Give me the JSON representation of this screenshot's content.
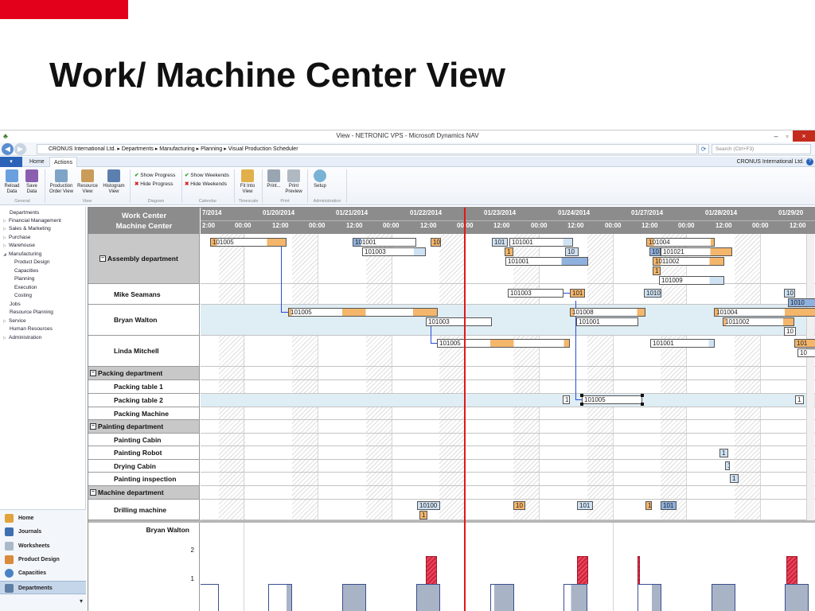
{
  "slide": {
    "title": "Work/ Machine Center View"
  },
  "window": {
    "title": "View - NETRONIC VPS - Microsoft Dynamics NAV",
    "min": "–",
    "max": "▫",
    "close": "×"
  },
  "address": {
    "breadcrumb": "CRONUS International Ltd.  ▸  Departments  ▸  Manufacturing  ▸  Planning  ▸  Visual Production Scheduler",
    "search_placeholder": "Search (Ctrl+F3)"
  },
  "ribbon": {
    "tabs": [
      "Home",
      "Actions"
    ],
    "company": "CRONUS International Ltd.",
    "buttons": {
      "reload": "Reload Data",
      "save": "Save Data",
      "prod_order_view": "Production Order View",
      "resource_view": "Resource View",
      "histogram_view": "Histogram View",
      "fit_into_view": "Fit Into View",
      "print": "Print...",
      "print_preview": "Print Preview",
      "setup": "Setup"
    },
    "small": {
      "show_progress": "Show Progress",
      "hide_progress": "Hide Progress",
      "show_weekends": "Show Weekends",
      "hide_weekends": "Hide Weekends"
    },
    "groups": {
      "general": "General",
      "view": "View",
      "diagram": "Diagram",
      "calendar": "Calendar",
      "timescale": "Timescale",
      "print": "Print",
      "administration": "Administration"
    }
  },
  "leftnav": {
    "items": [
      "Departments",
      "Financial Management",
      "Sales & Marketing",
      "Purchase",
      "Warehouse",
      "Manufacturing",
      "Product Design",
      "Capacities",
      "Planning",
      "Execution",
      "Costing",
      "Jobs",
      "Resource Planning",
      "Service",
      "Human Resources",
      "Administration"
    ],
    "bottom": [
      "Home",
      "Journals",
      "Worksheets",
      "Product Design",
      "Capacities",
      "Departments"
    ]
  },
  "scheduler": {
    "header": {
      "line1": "Work Center",
      "line2": "Machine Center"
    },
    "days": [
      "7/2014",
      "01/20/2014",
      "01/21/2014",
      "01/22/2014",
      "01/23/2014",
      "01/24/2014",
      "01/27/2014",
      "01/28/2014",
      "01/29/20"
    ],
    "hours": [
      "2:00",
      "00:00",
      "12:00",
      "00:00",
      "12:00",
      "00:00",
      "12:00",
      "00:00",
      "12:00",
      "00:00",
      "12:00",
      "00:00",
      "12:00",
      "00:00",
      "12:00",
      "00:00",
      "12:00"
    ],
    "rows": [
      {
        "label": "Assembly department",
        "group": true
      },
      {
        "label": "Mike Seamans",
        "group": false
      },
      {
        "label": "Bryan Walton",
        "group": false
      },
      {
        "label": "Linda Mitchell",
        "group": false
      },
      {
        "label": "Packing department",
        "group": true
      },
      {
        "label": "Packing table 1",
        "group": false
      },
      {
        "label": "Packing table 2",
        "group": false
      },
      {
        "label": "Packing Machine",
        "group": false
      },
      {
        "label": "Painting department",
        "group": true
      },
      {
        "label": "Painting Cabin",
        "group": false
      },
      {
        "label": "Painting Robot",
        "group": false
      },
      {
        "label": "Drying Cabin",
        "group": false
      },
      {
        "label": "Painting inspection",
        "group": false
      },
      {
        "label": "Machine department",
        "group": true
      },
      {
        "label": "Drilling machine",
        "group": false
      }
    ],
    "bars": [
      "101005",
      "101001",
      "101003",
      "10",
      "101",
      "101001",
      "1",
      "10",
      "101001",
      "101004",
      "10",
      "101021",
      "1011002",
      "1",
      "101009",
      "101003",
      "101",
      "1010",
      "10",
      "1010",
      "101005",
      "101008",
      "101004",
      "101003",
      "101001",
      "1011002",
      "10",
      "101005",
      "101001",
      "101",
      "10",
      "1",
      "101005",
      "1",
      "1",
      "1",
      "1",
      "10100",
      "1",
      "10",
      "101",
      "1",
      "101"
    ],
    "histogram": {
      "resource": "Bryan Walton",
      "ticks": [
        "2",
        "1"
      ]
    }
  }
}
